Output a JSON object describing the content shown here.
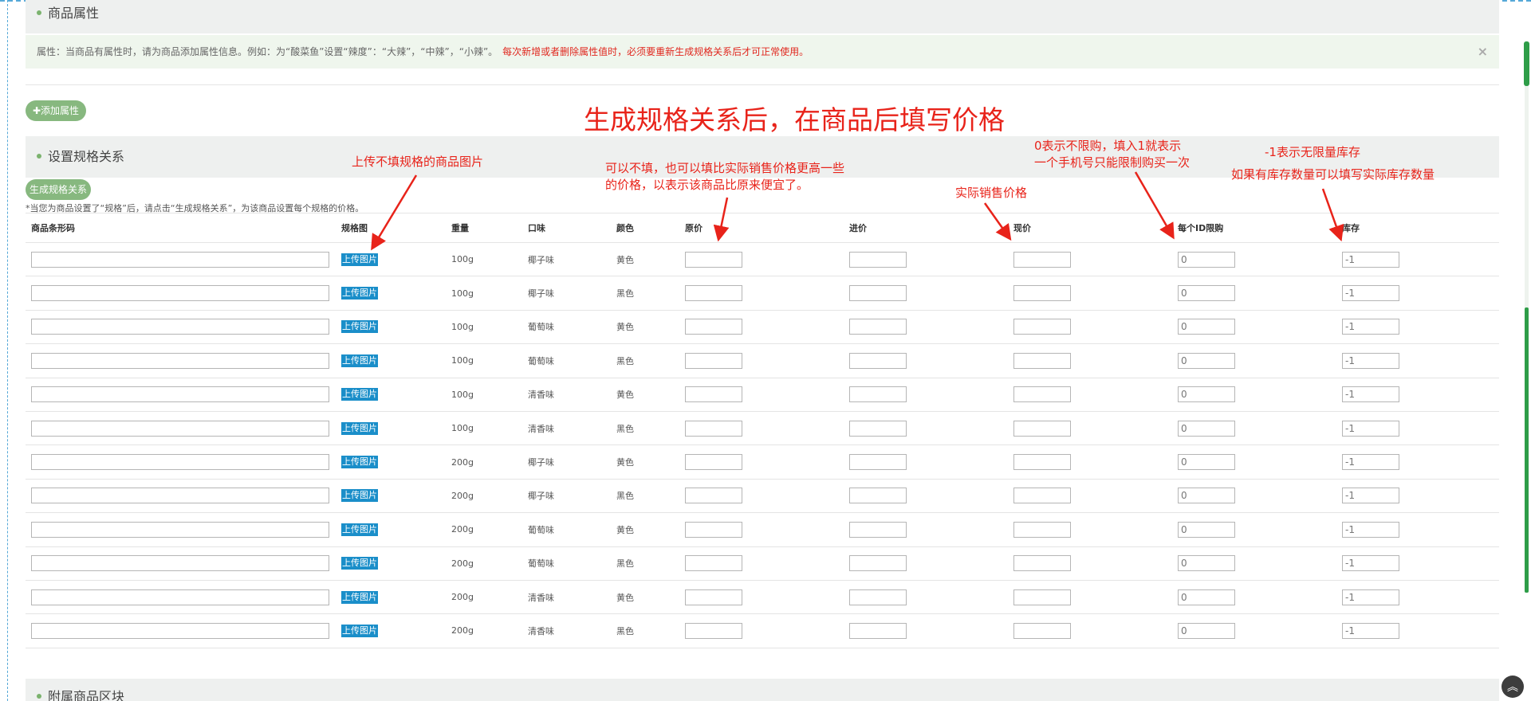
{
  "attr_section": {
    "title": "商品属性",
    "alert_text": "属性：当商品有属性时，请为商品添加属性信息。例如：为“酸菜鱼”设置“辣度”：“大辣”，“中辣”，“小辣”。",
    "alert_warning": "每次新增或者删除属性值时，必须要重新生成规格关系后才可正常使用。",
    "close_glyph": "×",
    "add_button": "✚添加属性"
  },
  "spec_section": {
    "title": "设置规格关系",
    "generate_button": "生成规格关系",
    "hint": "*当您为商品设置了“规格”后，请点击“生成规格关系”，为该商品设置每个规格的价格。"
  },
  "annotations": {
    "main": "生成规格关系后，在商品后填写价格",
    "upload_note": "上传不填规格的商品图片",
    "original_price_note_1": "可以不填，也可以填比实际销售价格更高一些",
    "original_price_note_2": "的价格，以表示该商品比原来便宜了。",
    "price_note": "实际销售价格",
    "limit_note_1": "0表示不限购，填入1就表示",
    "limit_note_2": "一个手机号只能限制购买一次",
    "stock_note_1": "-1表示无限量库存",
    "stock_note_2": "如果有库存数量可以填写实际库存数量"
  },
  "table": {
    "headers": {
      "barcode": "商品条形码",
      "image": "规格图",
      "weight": "重量",
      "flavor": "口味",
      "color": "颜色",
      "original_price": "原价",
      "cost_price": "进价",
      "price": "现价",
      "limit": "每个ID限购",
      "stock": "库存"
    },
    "upload_label": "上传图片",
    "rows": [
      {
        "weight": "100g",
        "flavor": "椰子味",
        "color": "黄色",
        "limit": "0",
        "stock": "-1"
      },
      {
        "weight": "100g",
        "flavor": "椰子味",
        "color": "黑色",
        "limit": "0",
        "stock": "-1"
      },
      {
        "weight": "100g",
        "flavor": "葡萄味",
        "color": "黄色",
        "limit": "0",
        "stock": "-1"
      },
      {
        "weight": "100g",
        "flavor": "葡萄味",
        "color": "黑色",
        "limit": "0",
        "stock": "-1"
      },
      {
        "weight": "100g",
        "flavor": "清香味",
        "color": "黄色",
        "limit": "0",
        "stock": "-1"
      },
      {
        "weight": "100g",
        "flavor": "清香味",
        "color": "黑色",
        "limit": "0",
        "stock": "-1"
      },
      {
        "weight": "200g",
        "flavor": "椰子味",
        "color": "黄色",
        "limit": "0",
        "stock": "-1"
      },
      {
        "weight": "200g",
        "flavor": "椰子味",
        "color": "黑色",
        "limit": "0",
        "stock": "-1"
      },
      {
        "weight": "200g",
        "flavor": "葡萄味",
        "color": "黄色",
        "limit": "0",
        "stock": "-1"
      },
      {
        "weight": "200g",
        "flavor": "葡萄味",
        "color": "黑色",
        "limit": "0",
        "stock": "-1"
      },
      {
        "weight": "200g",
        "flavor": "清香味",
        "color": "黄色",
        "limit": "0",
        "stock": "-1"
      },
      {
        "weight": "200g",
        "flavor": "清香味",
        "color": "黑色",
        "limit": "0",
        "stock": "-1"
      }
    ]
  },
  "bottom_section": {
    "title": "附属商品区块"
  },
  "back_to_top_glyph": "︽",
  "colors": {
    "accent_green": "#87b87f",
    "annotation_red": "#e8231a",
    "upload_blue": "#1a8ec9",
    "scroll_green": "#2e9d48"
  }
}
